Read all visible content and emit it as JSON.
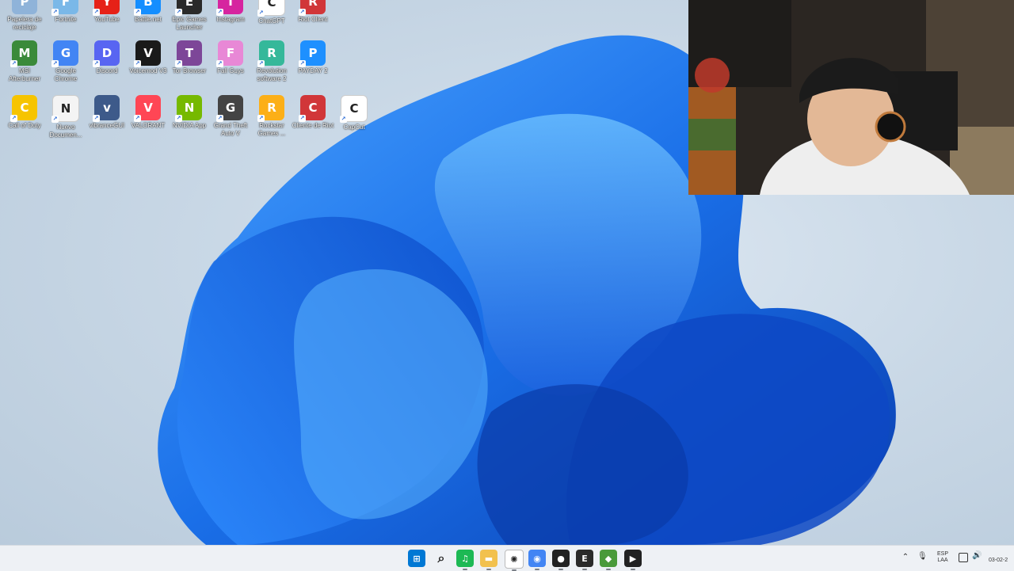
{
  "desktop": {
    "icons": [
      {
        "label": "Papelera de reciclaje",
        "icon": "recycle-bin-icon",
        "color": "#8fb3d9"
      },
      {
        "label": "Fortnite",
        "icon": "fortnite-icon",
        "color": "#7ab8e8"
      },
      {
        "label": "YouTube",
        "icon": "youtube-icon",
        "color": "#e62117"
      },
      {
        "label": "Battle.net",
        "icon": "battlenet-icon",
        "color": "#148eff"
      },
      {
        "label": "Epic Games Launcher",
        "icon": "epic-games-icon",
        "color": "#2a2a2a"
      },
      {
        "label": "Instagram",
        "icon": "instagram-icon",
        "color": "#d6249f"
      },
      {
        "label": "ChatGPT",
        "icon": "chatgpt-icon",
        "color": "#ffffff"
      },
      {
        "label": "Riot Client",
        "icon": "riot-client-icon",
        "color": "#d13639"
      },
      {
        "label": "MSI Afterburner",
        "icon": "msi-afterburner-icon",
        "color": "#3a8a3a"
      },
      {
        "label": "Google Chrome",
        "icon": "chrome-icon",
        "color": "#4285f4"
      },
      {
        "label": "Discord",
        "icon": "discord-icon",
        "color": "#5865f2"
      },
      {
        "label": "Voicemod V3",
        "icon": "voicemod-icon",
        "color": "#1a1a1a"
      },
      {
        "label": "Tor Browser",
        "icon": "tor-browser-icon",
        "color": "#7d4698"
      },
      {
        "label": "Fall Guys",
        "icon": "fall-guys-icon",
        "color": "#e888d6"
      },
      {
        "label": "Revolution software 2",
        "icon": "revolution-icon",
        "color": "#35b89a"
      },
      {
        "label": "PAYDAY 2",
        "icon": "payday2-icon",
        "color": "#1e90ff"
      },
      {
        "label": "Call of Duty",
        "icon": "warning-icon",
        "color": "#f6c400"
      },
      {
        "label": "Nuevo Documen...",
        "icon": "document-icon",
        "color": "#f4f4f4"
      },
      {
        "label": "vibranceGUI",
        "icon": "gear-icon",
        "color": "#3d5a8a"
      },
      {
        "label": "VALORANT",
        "icon": "valorant-icon",
        "color": "#ff4655"
      },
      {
        "label": "NVIDIA App",
        "icon": "nvidia-icon",
        "color": "#76b900"
      },
      {
        "label": "Grand Theft Auto V",
        "icon": "gta5-icon",
        "color": "#444444"
      },
      {
        "label": "Rockstar Games ...",
        "icon": "rockstar-icon",
        "color": "#fcaf17"
      },
      {
        "label": "Cliente de Riot",
        "icon": "riot-fist-icon",
        "color": "#d13639"
      },
      {
        "label": "CapCut",
        "icon": "capcut-icon",
        "color": "#ffffff"
      }
    ]
  },
  "taskbar": {
    "items": [
      {
        "name": "start-button",
        "icon": "windows-start-icon",
        "color": "#0078d4",
        "glyph": "⊞"
      },
      {
        "name": "search-button",
        "icon": "search-icon",
        "color": "#222222",
        "glyph": "⌕"
      },
      {
        "name": "taskbar-spotify",
        "icon": "spotify-icon",
        "color": "#1db954",
        "glyph": "♫"
      },
      {
        "name": "taskbar-file-explorer",
        "icon": "folder-icon",
        "color": "#f2c14e",
        "glyph": "▬"
      },
      {
        "name": "taskbar-chatgpt",
        "icon": "chatgpt-icon",
        "color": "#ffffff",
        "glyph": "✺"
      },
      {
        "name": "taskbar-chrome",
        "icon": "chrome-icon",
        "color": "#4285f4",
        "glyph": "◉"
      },
      {
        "name": "taskbar-app",
        "icon": "app-icon",
        "color": "#222222",
        "glyph": "●"
      },
      {
        "name": "taskbar-epic-games",
        "icon": "epic-games-icon",
        "color": "#2a2a2a",
        "glyph": "E"
      },
      {
        "name": "taskbar-app-green",
        "icon": "app-green-icon",
        "color": "#4a9a3a",
        "glyph": "◆"
      },
      {
        "name": "taskbar-media-player",
        "icon": "media-player-icon",
        "color": "#222222",
        "glyph": "▶"
      }
    ],
    "tray": {
      "chevron_icon": "chevron-up-icon",
      "mic_icon": "microphone-icon",
      "lang_top": "ESP",
      "lang_bottom": "LAA",
      "network_icon": "network-icon",
      "volume_icon": "speaker-icon",
      "date": "03-02-2"
    }
  }
}
